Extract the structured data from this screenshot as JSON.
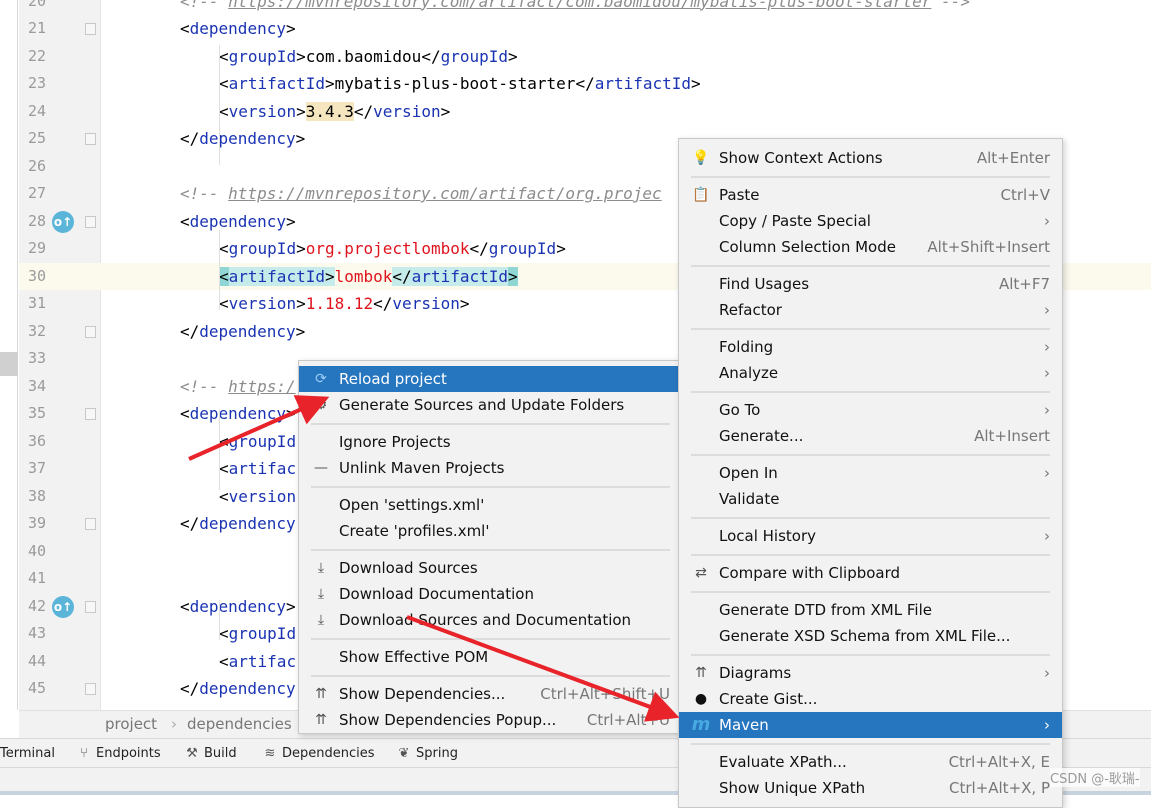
{
  "editor": {
    "first_line": 20,
    "current_line": 30,
    "lines": [
      {
        "n": 20,
        "i": 1,
        "t": [
          [
            "c",
            "<!-- "
          ],
          [
            "u",
            "https://mvnrepository.com/artifact/com.baomidou/mybatis-plus-boot-starter"
          ],
          [
            "c",
            " -->"
          ]
        ]
      },
      {
        "n": 21,
        "i": 1,
        "fold": true,
        "t": [
          [
            "b",
            "<"
          ],
          [
            "n",
            "dependency"
          ],
          [
            "b",
            ">"
          ]
        ]
      },
      {
        "n": 22,
        "i": 2,
        "t": [
          [
            "b",
            "<"
          ],
          [
            "n",
            "groupId"
          ],
          [
            "b",
            ">"
          ],
          [
            "v",
            "com.baomidou"
          ],
          [
            "b",
            "</"
          ],
          [
            "n",
            "groupId"
          ],
          [
            "b",
            ">"
          ]
        ]
      },
      {
        "n": 23,
        "i": 2,
        "t": [
          [
            "b",
            "<"
          ],
          [
            "n",
            "artifactId"
          ],
          [
            "b",
            ">"
          ],
          [
            "v",
            "mybatis-plus-boot-starter"
          ],
          [
            "b",
            "</"
          ],
          [
            "n",
            "artifactId"
          ],
          [
            "b",
            ">"
          ]
        ]
      },
      {
        "n": 24,
        "i": 2,
        "t": [
          [
            "b",
            "<"
          ],
          [
            "n",
            "version"
          ],
          [
            "b",
            ">"
          ],
          [
            "y",
            "3.4.3"
          ],
          [
            "b",
            "</"
          ],
          [
            "n",
            "version"
          ],
          [
            "b",
            ">"
          ]
        ]
      },
      {
        "n": 25,
        "i": 1,
        "fold": true,
        "t": [
          [
            "b",
            "</"
          ],
          [
            "n",
            "dependency"
          ],
          [
            "b",
            ">"
          ]
        ]
      },
      {
        "n": 26,
        "i": 0,
        "t": []
      },
      {
        "n": 27,
        "i": 1,
        "t": [
          [
            "c",
            "<!-- "
          ],
          [
            "u",
            "https://mvnrepository.com/artifact/org.projec"
          ]
        ]
      },
      {
        "n": 28,
        "i": 1,
        "fold": true,
        "gutter_icon": "override-icon",
        "t": [
          [
            "b",
            "<"
          ],
          [
            "n",
            "dependency"
          ],
          [
            "b",
            ">"
          ]
        ]
      },
      {
        "n": 29,
        "i": 2,
        "t": [
          [
            "b",
            "<"
          ],
          [
            "n",
            "groupId"
          ],
          [
            "b",
            ">"
          ],
          [
            "r",
            "org.projectlombok"
          ],
          [
            "b",
            "</"
          ],
          [
            "n",
            "groupId"
          ],
          [
            "b",
            ">"
          ]
        ]
      },
      {
        "n": 30,
        "i": 2,
        "t": [
          [
            "h2",
            "<"
          ],
          [
            "hn",
            "artifactId"
          ],
          [
            "h",
            ">"
          ],
          [
            "r",
            "lombok"
          ],
          [
            "h",
            "</"
          ],
          [
            "hn",
            "artifactId"
          ],
          [
            "h2",
            ">"
          ]
        ]
      },
      {
        "n": 31,
        "i": 2,
        "t": [
          [
            "b",
            "<"
          ],
          [
            "n",
            "version"
          ],
          [
            "b",
            ">"
          ],
          [
            "r",
            "1.18.12"
          ],
          [
            "b",
            "</"
          ],
          [
            "n",
            "version"
          ],
          [
            "b",
            ">"
          ]
        ]
      },
      {
        "n": 32,
        "i": 1,
        "fold": true,
        "t": [
          [
            "b",
            "</"
          ],
          [
            "n",
            "dependency"
          ],
          [
            "b",
            ">"
          ]
        ]
      },
      {
        "n": 33,
        "i": 0,
        "t": []
      },
      {
        "n": 34,
        "i": 1,
        "t": [
          [
            "c",
            "<!-- "
          ],
          [
            "u",
            "https:/"
          ]
        ]
      },
      {
        "n": 35,
        "i": 1,
        "fold": true,
        "t": [
          [
            "b",
            "<"
          ],
          [
            "n",
            "dependency"
          ],
          [
            "b",
            ">"
          ]
        ]
      },
      {
        "n": 36,
        "i": 2,
        "t": [
          [
            "b",
            "<"
          ],
          [
            "n",
            "groupId"
          ]
        ]
      },
      {
        "n": 37,
        "i": 2,
        "t": [
          [
            "b",
            "<"
          ],
          [
            "n",
            "artifac"
          ]
        ]
      },
      {
        "n": 38,
        "i": 2,
        "t": [
          [
            "b",
            "<"
          ],
          [
            "n",
            "version"
          ]
        ]
      },
      {
        "n": 39,
        "i": 1,
        "fold": true,
        "t": [
          [
            "b",
            "</"
          ],
          [
            "n",
            "dependency"
          ]
        ]
      },
      {
        "n": 40,
        "i": 0,
        "t": []
      },
      {
        "n": 41,
        "i": 0,
        "t": []
      },
      {
        "n": 42,
        "i": 1,
        "fold": true,
        "gutter_icon": "override-icon",
        "t": [
          [
            "b",
            "<"
          ],
          [
            "n",
            "dependency"
          ],
          [
            "b",
            ">"
          ]
        ]
      },
      {
        "n": 43,
        "i": 2,
        "t": [
          [
            "b",
            "<"
          ],
          [
            "n",
            "groupId"
          ]
        ]
      },
      {
        "n": 44,
        "i": 2,
        "t": [
          [
            "b",
            "<"
          ],
          [
            "n",
            "artifac"
          ]
        ]
      },
      {
        "n": 45,
        "i": 1,
        "fold": true,
        "t": [
          [
            "b",
            "</"
          ],
          [
            "n",
            "dependency"
          ]
        ]
      }
    ]
  },
  "breadcrumb": {
    "items": [
      "project",
      "dependencies"
    ],
    "sep": "›"
  },
  "toolwindows": [
    {
      "label": "Terminal",
      "icon": ""
    },
    {
      "label": "Endpoints",
      "icon": "endpoints-icon"
    },
    {
      "label": "Build",
      "icon": "hammer-icon"
    },
    {
      "label": "Dependencies",
      "icon": "layers-icon"
    },
    {
      "label": "Spring",
      "icon": "spring-leaf-icon"
    }
  ],
  "maven_menu": [
    {
      "label": "Reload project",
      "icon": "reload-icon",
      "selected": true
    },
    {
      "label": "Generate Sources and Update Folders",
      "icon": "generate-sources-icon"
    },
    {
      "sep": true
    },
    {
      "label": "Ignore Projects"
    },
    {
      "label": "Unlink Maven Projects",
      "icon": "minus-icon"
    },
    {
      "sep": true
    },
    {
      "label": "Open 'settings.xml'"
    },
    {
      "label": "Create 'profiles.xml'"
    },
    {
      "sep": true
    },
    {
      "label": "Download Sources",
      "icon": "download-icon"
    },
    {
      "label": "Download Documentation",
      "icon": "download-icon"
    },
    {
      "label": "Download Sources and Documentation",
      "icon": "download-icon"
    },
    {
      "sep": true
    },
    {
      "label": "Show Effective POM"
    },
    {
      "sep": true
    },
    {
      "label": "Show Dependencies...",
      "icon": "diagram-icon",
      "shortcut": "Ctrl+Alt+Shift+U"
    },
    {
      "label": "Show Dependencies Popup...",
      "icon": "diagram-icon",
      "shortcut": "Ctrl+Alt+U"
    }
  ],
  "context_menu": [
    {
      "label": "Show Context Actions",
      "icon": "bulb-icon",
      "shortcut": "Alt+Enter"
    },
    {
      "sep": true
    },
    {
      "label": "Paste",
      "icon": "clipboard-icon",
      "shortcut": "Ctrl+V"
    },
    {
      "label": "Copy / Paste Special",
      "submenu": true
    },
    {
      "label": "Column Selection Mode",
      "shortcut": "Alt+Shift+Insert"
    },
    {
      "sep": true
    },
    {
      "label": "Find Usages",
      "shortcut": "Alt+F7"
    },
    {
      "label": "Refactor",
      "submenu": true
    },
    {
      "sep": true
    },
    {
      "label": "Folding",
      "submenu": true
    },
    {
      "label": "Analyze",
      "submenu": true
    },
    {
      "sep": true
    },
    {
      "label": "Go To",
      "submenu": true
    },
    {
      "label": "Generate...",
      "shortcut": "Alt+Insert"
    },
    {
      "sep": true
    },
    {
      "label": "Open In",
      "submenu": true
    },
    {
      "label": "Validate"
    },
    {
      "sep": true
    },
    {
      "label": "Local History",
      "submenu": true
    },
    {
      "sep": true
    },
    {
      "label": "Compare with Clipboard",
      "icon": "compare-icon"
    },
    {
      "sep": true
    },
    {
      "label": "Generate DTD from XML File"
    },
    {
      "label": "Generate XSD Schema from XML File..."
    },
    {
      "sep": true
    },
    {
      "label": "Diagrams",
      "icon": "diagram-icon",
      "submenu": true
    },
    {
      "label": "Create Gist...",
      "icon": "github-icon"
    },
    {
      "label": "Maven",
      "icon": "maven-icon",
      "submenu": true,
      "selected": true
    },
    {
      "sep": true
    },
    {
      "label": "Evaluate XPath...",
      "shortcut": "Ctrl+Alt+X, E"
    },
    {
      "label": "Show Unique XPath",
      "shortcut": "Ctrl+Alt+X, P"
    }
  ],
  "annotation_color": "#e8232a",
  "watermark": "CSDN @-耿瑞-"
}
